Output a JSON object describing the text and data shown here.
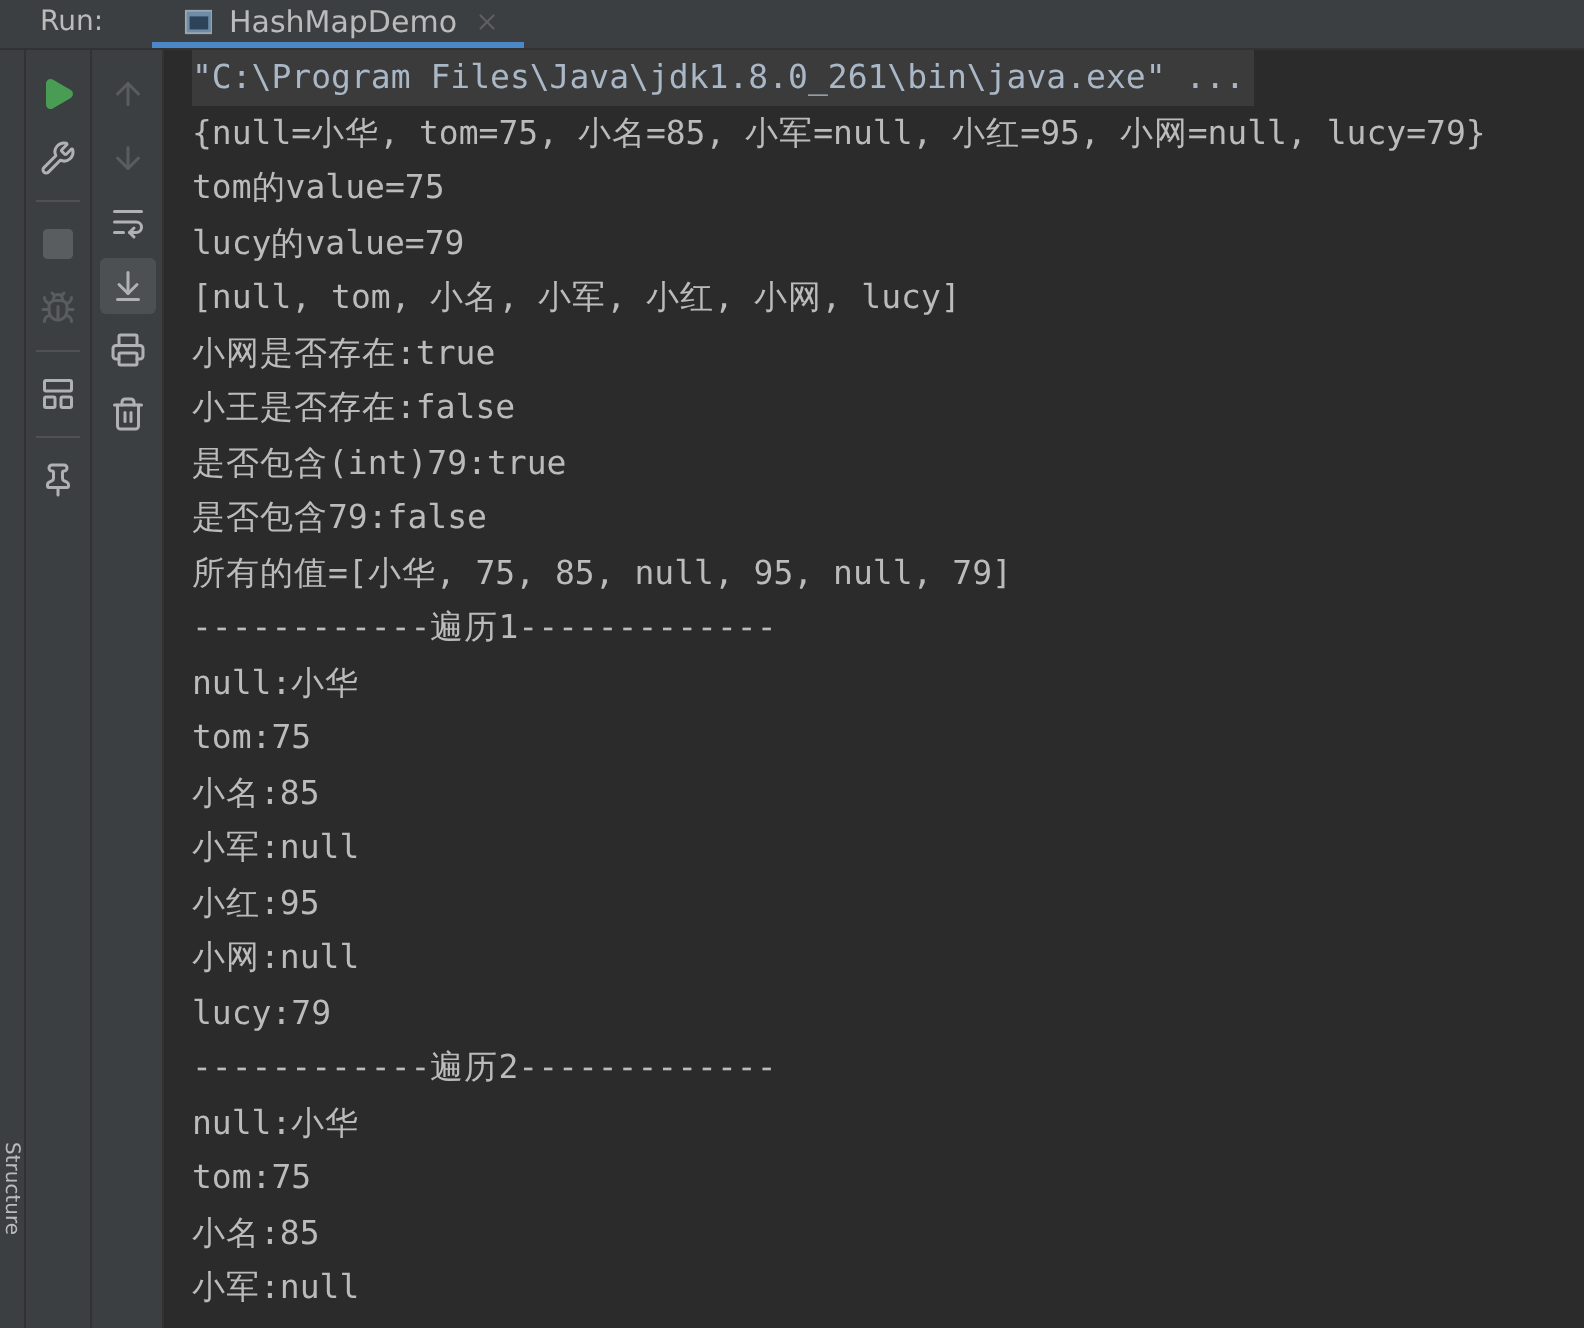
{
  "header": {
    "label": "Run:",
    "tabs": [
      {
        "title": "HashMapDemo",
        "selected": true
      }
    ]
  },
  "left_toolbar": [
    {
      "kind": "run",
      "disabled": false
    },
    {
      "kind": "wrench",
      "disabled": false
    },
    {
      "kind": "stop",
      "disabled": true
    },
    {
      "kind": "bug",
      "disabled": true
    },
    {
      "kind": "layout",
      "disabled": false
    },
    {
      "kind": "pin",
      "disabled": false
    }
  ],
  "console_toolbar": [
    {
      "kind": "up",
      "disabled": true,
      "selected": false
    },
    {
      "kind": "down",
      "disabled": true,
      "selected": false
    },
    {
      "kind": "wrap",
      "disabled": false,
      "selected": false
    },
    {
      "kind": "scroll-end",
      "disabled": false,
      "selected": true
    },
    {
      "kind": "print",
      "disabled": false,
      "selected": false
    },
    {
      "kind": "trash",
      "disabled": false,
      "selected": false
    }
  ],
  "side_stripe": {
    "label": "Structure"
  },
  "console_lines": [
    {
      "kind": "command",
      "text": "\"C:\\Program Files\\Java\\jdk1.8.0_261\\bin\\java.exe\" ..."
    },
    {
      "kind": "output",
      "text": "{null=小华, tom=75, 小名=85, 小军=null, 小红=95, 小网=null, lucy=79}"
    },
    {
      "kind": "output",
      "text": "tom的value=75"
    },
    {
      "kind": "output",
      "text": "lucy的value=79"
    },
    {
      "kind": "output",
      "text": "[null, tom, 小名, 小军, 小红, 小网, lucy]"
    },
    {
      "kind": "output",
      "text": "小网是否存在:true"
    },
    {
      "kind": "output",
      "text": "小王是否存在:false"
    },
    {
      "kind": "output",
      "text": "是否包含(int)79:true"
    },
    {
      "kind": "output",
      "text": "是否包含79:false"
    },
    {
      "kind": "output",
      "text": "所有的值=[小华, 75, 85, null, 95, null, 79]"
    },
    {
      "kind": "output",
      "text": "------------遍历1-------------"
    },
    {
      "kind": "output",
      "text": "null:小华"
    },
    {
      "kind": "output",
      "text": "tom:75"
    },
    {
      "kind": "output",
      "text": "小名:85"
    },
    {
      "kind": "output",
      "text": "小军:null"
    },
    {
      "kind": "output",
      "text": "小红:95"
    },
    {
      "kind": "output",
      "text": "小网:null"
    },
    {
      "kind": "output",
      "text": "lucy:79"
    },
    {
      "kind": "output",
      "text": "------------遍历2-------------"
    },
    {
      "kind": "output",
      "text": "null:小华"
    },
    {
      "kind": "output",
      "text": "tom:75"
    },
    {
      "kind": "output",
      "text": "小名:85"
    },
    {
      "kind": "output",
      "text": "小军:null"
    }
  ]
}
